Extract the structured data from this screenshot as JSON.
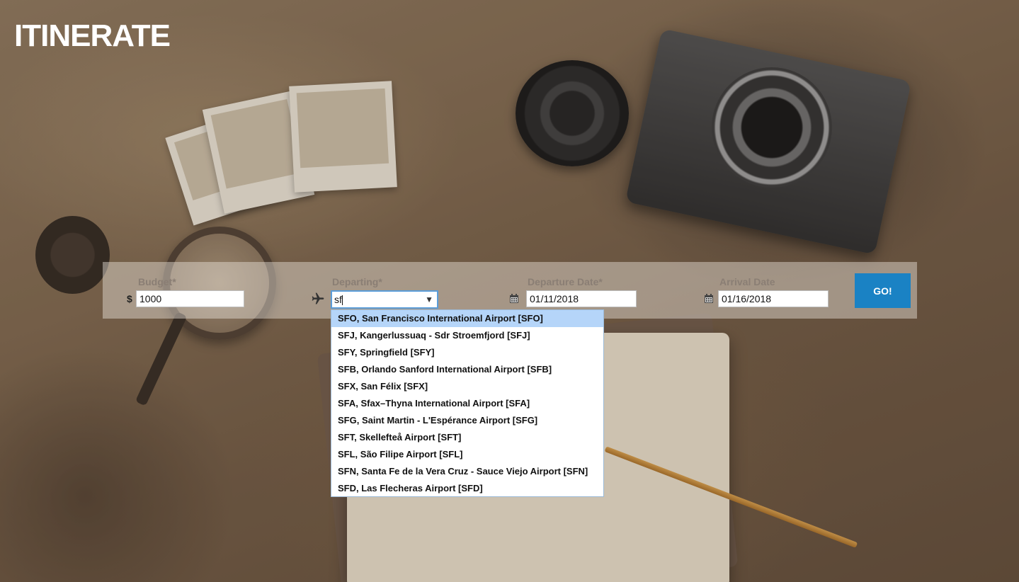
{
  "app": {
    "title": "ITINERATE"
  },
  "form": {
    "budget": {
      "label": "Budget*",
      "currency_symbol": "$",
      "value": "1000"
    },
    "departing": {
      "label": "Departing*",
      "value": "sf",
      "icon": "plane-icon"
    },
    "departure_date": {
      "label": "Departure Date*",
      "value": "01/11/2018",
      "icon": "calendar-icon"
    },
    "arrival_date": {
      "label": "Arrival Date",
      "value": "01/16/2018",
      "icon": "calendar-icon"
    },
    "go_label": "GO!"
  },
  "dropdown": {
    "items": [
      "SFO, San Francisco International Airport [SFO]",
      "SFJ, Kangerlussuaq - Sdr Stroemfjord [SFJ]",
      "SFY, Springfield [SFY]",
      "SFB, Orlando Sanford International Airport [SFB]",
      "SFX, San Félix [SFX]",
      "SFA, Sfax–Thyna International Airport [SFA]",
      "SFG, Saint Martin - L'Espérance Airport [SFG]",
      "SFT, Skellefteå Airport [SFT]",
      "SFL, São Filipe Airport [SFL]",
      "SFN, Santa Fe de la Vera Cruz - Sauce Viejo Airport [SFN]",
      "SFD, Las Flecheras Airport [SFD]"
    ],
    "highlighted_index": 0
  },
  "colors": {
    "accent": "#1a82c4",
    "highlight": "#b5d5f9"
  }
}
